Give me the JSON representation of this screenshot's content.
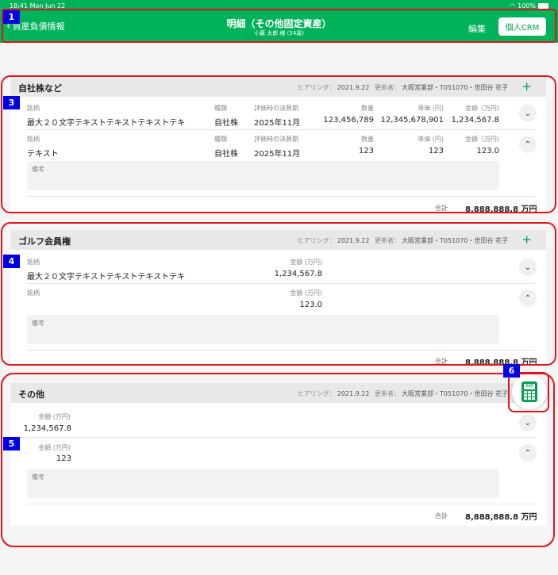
{
  "status_bar": {
    "time": "18:41 Mon Jun 22",
    "battery": "100%"
  },
  "header": {
    "back_label": "資産負債情報",
    "title": "明細（その他固定資産）",
    "subtitle": "小暮 太郎 様 (54歳)",
    "edit_label": "編集",
    "crm_label": "個人CRM"
  },
  "annotations": [
    "1",
    "3",
    "4",
    "5",
    "6"
  ],
  "sections": [
    {
      "title": "自社株など",
      "hearing_label": "ヒアリング：",
      "hearing_date": "2021.9.22",
      "updater_label": "更新者：",
      "updater": "大阪営業部・T051070・世田谷 花子",
      "add_icon": "+",
      "columns": [
        "銘柄",
        "種類",
        "評価時の決算期",
        "数量",
        "単価 (円)",
        "金額（万円)"
      ],
      "rows": [
        {
          "name": "最大２０文字テキストテキストテキストテキ",
          "type": "自社株",
          "period": "2025年11月",
          "qty": "123,456,789",
          "unit_price": "12,345,678,901",
          "amount": "1,234,567.8",
          "toggle": "chevron-down"
        },
        {
          "name": "テキスト",
          "type": "自社株",
          "period": "2025年11月",
          "qty": "123",
          "unit_price": "123",
          "amount": "123.0",
          "toggle": "chevron-up",
          "memo_label": "備考"
        }
      ],
      "total_label": "合計",
      "total_value": "8,888,888.8 万円"
    },
    {
      "title": "ゴルフ会員権",
      "hearing_label": "ヒアリング：",
      "hearing_date": "2021.9.22",
      "updater_label": "更新者：",
      "updater": "大阪営業部・T051070・世田谷 花子",
      "add_icon": "+",
      "columns": [
        "銘柄",
        "金額 (万円)"
      ],
      "rows": [
        {
          "name": "最大２０文字テキストテキストテキストテキ",
          "amount": "1,234,567.8",
          "toggle": "chevron-down"
        },
        {
          "name": "",
          "amount": "123.0",
          "toggle": "chevron-up",
          "memo_label": "備考"
        }
      ],
      "total_label": "合計",
      "total_value": "8,888,888.8 万円"
    },
    {
      "title": "その他",
      "hearing_label": "ヒアリング：",
      "hearing_date": "2021.9.22",
      "updater_label": "更新者：",
      "updater": "大阪営業部・T051070・世田谷 花子",
      "columns": [
        "金額 (万円)"
      ],
      "rows": [
        {
          "amount": "1,234,567.8",
          "toggle": "chevron-down"
        },
        {
          "amount": "123",
          "toggle": "chevron-up",
          "memo_label": "備考"
        }
      ],
      "total_label": "合計",
      "total_value": "8,888,888.8 万円"
    }
  ],
  "calculator": {
    "icon": "calculator-icon",
    "screen_text": "相続"
  },
  "colors": {
    "brand_green": "#00b25a",
    "annotation_red": "#e4131b",
    "badge_blue": "#0000e6"
  }
}
